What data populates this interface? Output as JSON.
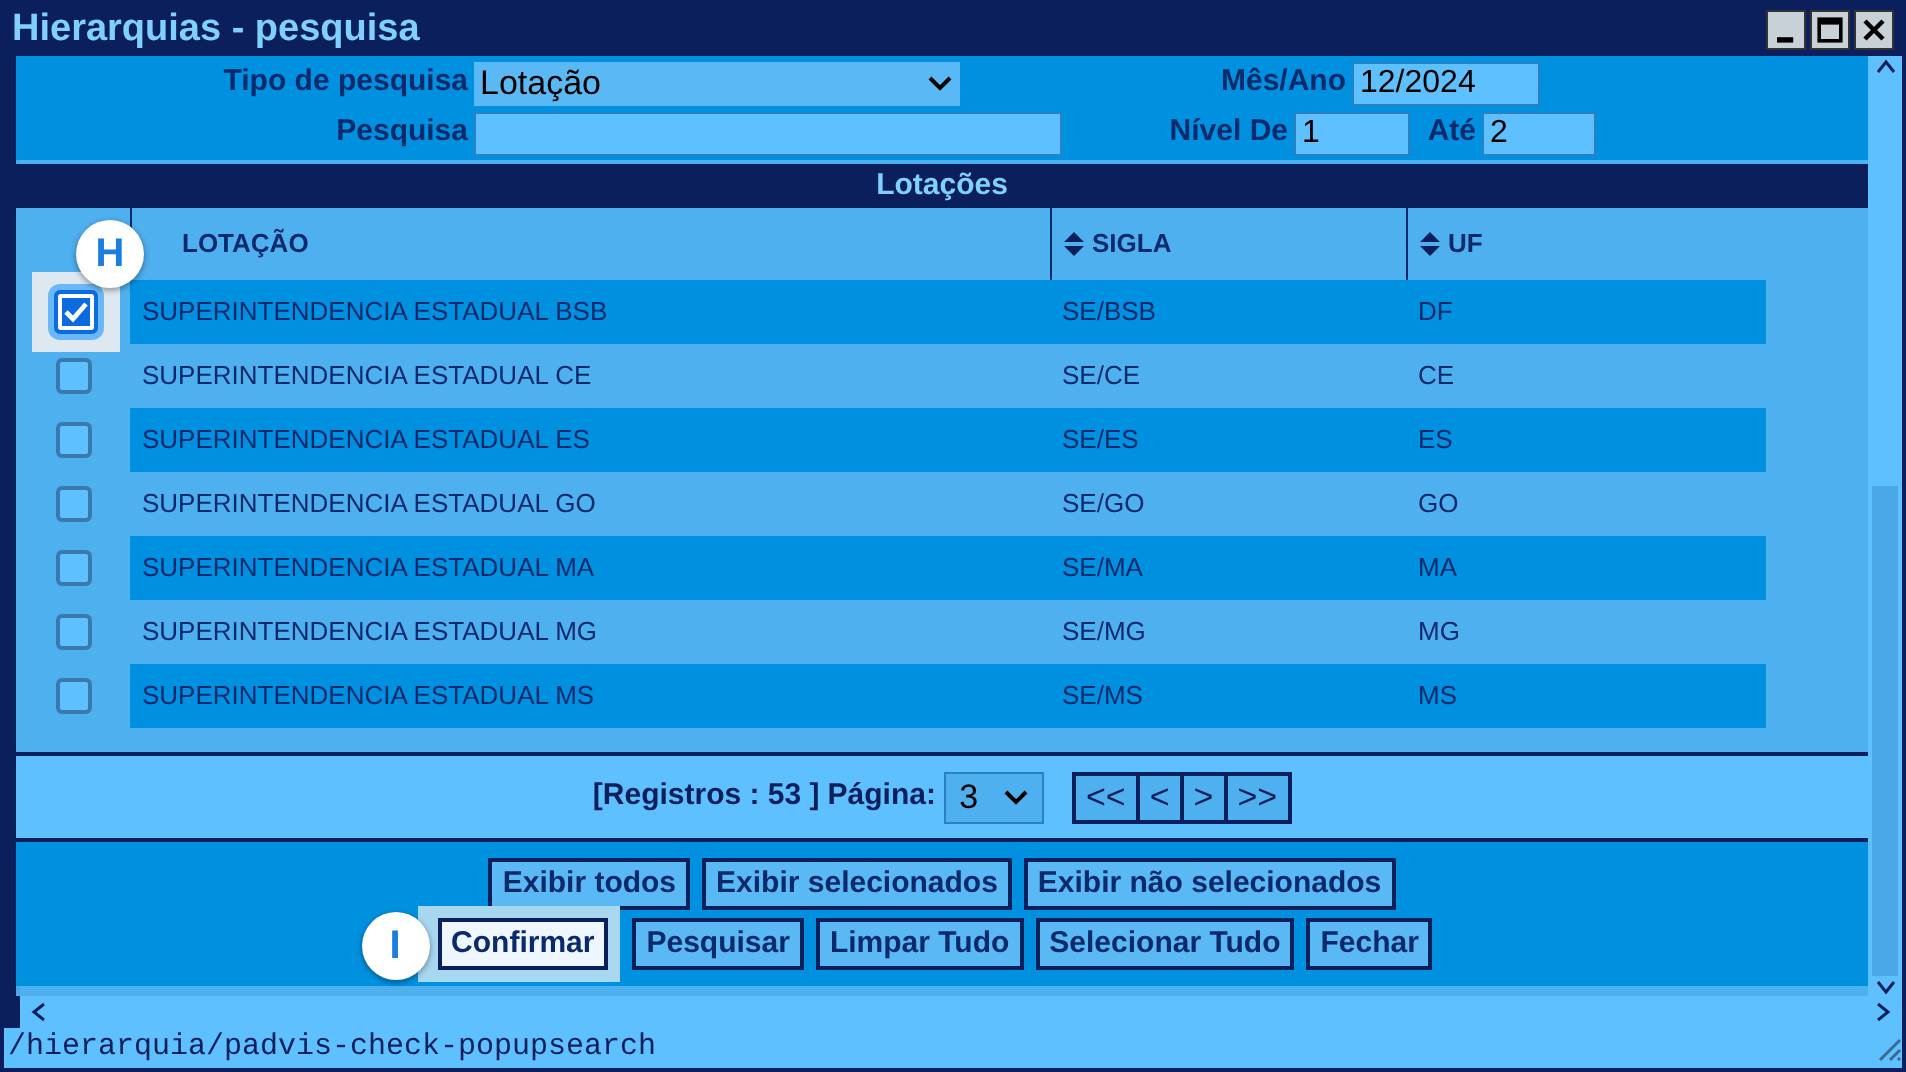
{
  "window": {
    "title": "Hierarquias - pesquisa"
  },
  "form": {
    "search_type": {
      "label": "Tipo de pesquisa",
      "value": "Lotação"
    },
    "month_year": {
      "label": "Mês/Ano",
      "value": "12/2024"
    },
    "search": {
      "label": "Pesquisa"
    },
    "level_from": {
      "label": "Nível De",
      "value": "1"
    },
    "level_to": {
      "label": "Até",
      "value": "2"
    }
  },
  "table": {
    "title": "Lotações",
    "columns": [
      "LOTAÇÃO",
      "SIGLA",
      "UF"
    ],
    "rows": [
      {
        "lotacao": "SUPERINTENDENCIA ESTADUAL BSB",
        "sigla": "SE/BSB",
        "uf": "DF",
        "checked": true,
        "callout": "H"
      },
      {
        "lotacao": "SUPERINTENDENCIA ESTADUAL CE",
        "sigla": "SE/CE",
        "uf": "CE",
        "checked": false
      },
      {
        "lotacao": "SUPERINTENDENCIA ESTADUAL ES",
        "sigla": "SE/ES",
        "uf": "ES",
        "checked": false
      },
      {
        "lotacao": "SUPERINTENDENCIA ESTADUAL GO",
        "sigla": "SE/GO",
        "uf": "GO",
        "checked": false
      },
      {
        "lotacao": "SUPERINTENDENCIA ESTADUAL MA",
        "sigla": "SE/MA",
        "uf": "MA",
        "checked": false
      },
      {
        "lotacao": "SUPERINTENDENCIA ESTADUAL MG",
        "sigla": "SE/MG",
        "uf": "MG",
        "checked": false
      },
      {
        "lotacao": "SUPERINTENDENCIA ESTADUAL MS",
        "sigla": "SE/MS",
        "uf": "MS",
        "checked": false
      }
    ]
  },
  "pagination": {
    "records": "[Registros : 53 ]",
    "page_label": "Página:",
    "page": "3",
    "nav": [
      "<<",
      "<",
      ">",
      ">>"
    ]
  },
  "button_rows": [
    [
      {
        "label": "Exibir todos",
        "focused": false
      },
      {
        "label": "Exibir selecionados",
        "focused": false
      },
      {
        "label": "Exibir não selecionados",
        "focused": false
      }
    ],
    [
      {
        "label": "Confirmar",
        "focused": true,
        "callout": "I"
      },
      {
        "label": "Pesquisar",
        "focused": false
      },
      {
        "label": "Limpar Tudo",
        "focused": false
      },
      {
        "label": "Selecionar Tudo",
        "focused": false
      },
      {
        "label": "Fechar",
        "focused": false
      }
    ]
  ],
  "status_bar": "/hierarquia/padvis-check-popupsearch"
}
